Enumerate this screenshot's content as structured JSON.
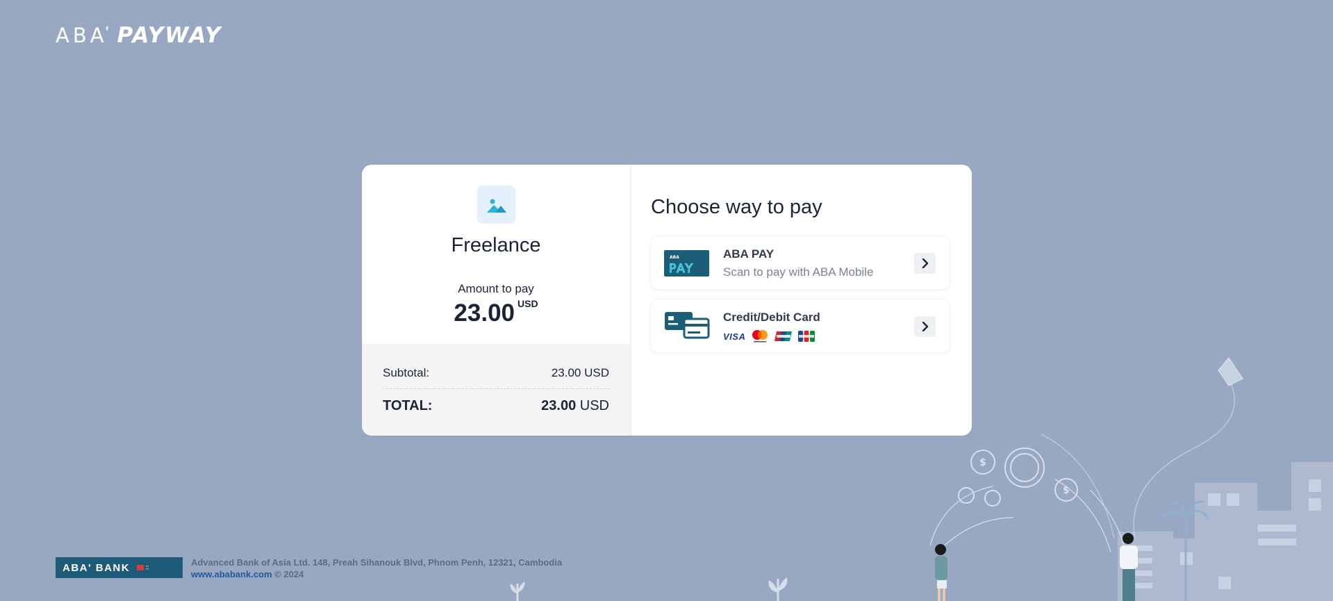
{
  "header": {
    "logo_aba": "ABA",
    "logo_tick": "'",
    "logo_payway": "PAYWAY"
  },
  "merchant": {
    "image_icon": "image-icon",
    "name": "Freelance",
    "amount_label": "Amount to pay",
    "amount": "23.00",
    "currency": "USD"
  },
  "summary": {
    "subtotal_label": "Subtotal:",
    "subtotal_value": "23.00 USD",
    "total_label": "TOTAL:",
    "total_amount": "23.00",
    "total_currency": "USD"
  },
  "payment": {
    "title": "Choose way to pay",
    "options": [
      {
        "title": "ABA PAY",
        "subtitle": "Scan to pay with ABA Mobile",
        "icon": "aba-pay-icon",
        "icon_top_text": "ABA",
        "icon_text": "PAY"
      },
      {
        "title": "Credit/Debit Card",
        "icon": "credit-card-icon",
        "card_brands": [
          "VISA",
          "Mastercard",
          "UnionPay",
          "JCB"
        ]
      }
    ]
  },
  "footer": {
    "logo_text": "ABA' BANK",
    "address": "Advanced Bank of Asia Ltd. 148, Preah Sihanouk Blvd, Phnom Penh, 12321, Cambodia",
    "website": "www.ababank.com",
    "copyright": "© 2024"
  },
  "colors": {
    "background": "#99a8c2",
    "card": "#ffffff",
    "summary_bg": "#f4f4f4",
    "brand_teal": "#1e5b78",
    "text_dark": "#1b2436"
  }
}
